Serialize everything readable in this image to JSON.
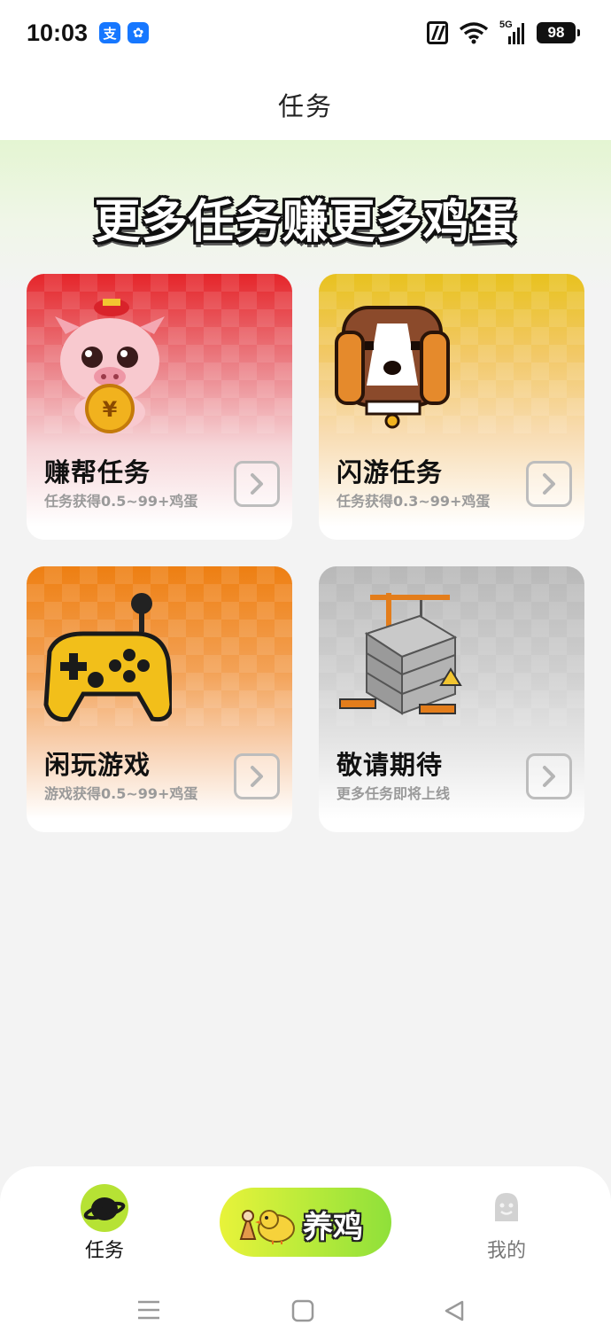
{
  "status_bar": {
    "time": "10:03",
    "app_badges": [
      "支",
      "✿"
    ],
    "network": "5G",
    "battery": "98"
  },
  "header": {
    "title": "任务"
  },
  "banner": {
    "title": "更多任务赚更多鸡蛋"
  },
  "cards": [
    {
      "title": "赚帮任务",
      "subtitle": "任务获得0.5~99+鸡蛋",
      "icon": "pig-coin-icon",
      "color": "#e5252a"
    },
    {
      "title": "闪游任务",
      "subtitle": "任务获得0.3~99+鸡蛋",
      "icon": "dog-icon",
      "color": "#e8c21f"
    },
    {
      "title": "闲玩游戏",
      "subtitle": "游戏获得0.5~99+鸡蛋",
      "icon": "gamepad-icon",
      "color": "#ee7f12"
    },
    {
      "title": "敬请期待",
      "subtitle": "更多任务即将上线",
      "icon": "construction-building-icon",
      "color": "#b8b8b8"
    }
  ],
  "bottom_nav": {
    "task_label": "任务",
    "raise_label": "养鸡",
    "mine_label": "我的",
    "accent": "#b6e234"
  }
}
